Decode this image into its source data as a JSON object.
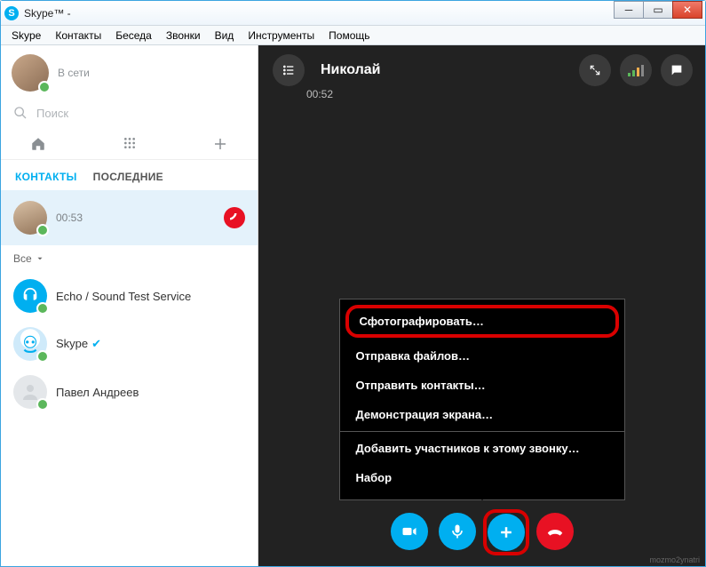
{
  "window": {
    "title": "Skype™ -"
  },
  "menu": {
    "skype": "Skype",
    "contacts": "Контакты",
    "chat": "Беседа",
    "calls": "Звонки",
    "view": "Вид",
    "tools": "Инструменты",
    "help": "Помощь"
  },
  "me": {
    "name": "",
    "status": "В сети"
  },
  "search": {
    "placeholder": "Поиск"
  },
  "tabs": {
    "contacts": "КОНТАКТЫ",
    "recent": "ПОСЛЕДНИЕ"
  },
  "filter": {
    "all": "Все"
  },
  "active_call_item": {
    "name": "",
    "time": "00:53"
  },
  "contacts": [
    {
      "name": "Echo / Sound Test Service"
    },
    {
      "name": "Skype"
    },
    {
      "name": "Павел Андреев"
    }
  ],
  "call": {
    "peer": "Николай",
    "timer": "00:52"
  },
  "popup": {
    "snapshot": "Сфотографировать…",
    "send_files": "Отправка файлов…",
    "send_contacts": "Отправить контакты…",
    "share_screen": "Демонстрация экрана…",
    "add_people": "Добавить участников к этому звонку…",
    "dial": "Набор"
  },
  "corner": "mozmo2ynatri"
}
